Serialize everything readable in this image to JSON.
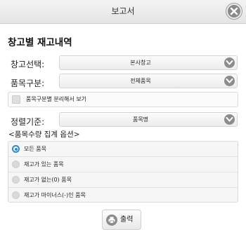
{
  "dialog": {
    "title": "보고서"
  },
  "heading": "창고별 재고내역",
  "fields": {
    "warehouse": {
      "label": "창고선택:",
      "value": "본사창고"
    },
    "category": {
      "label": "품목구분:",
      "value": "전체품목"
    },
    "separate_checkbox": {
      "label": "품목구분별 분리해서 보기",
      "checked": false
    },
    "sort": {
      "label": "정렬기준:",
      "value": "품목명"
    }
  },
  "options": {
    "title": "<품목수량 집계 옵션>",
    "items": [
      {
        "label": "모든 품목",
        "selected": true
      },
      {
        "label": "재고가 있는 품목",
        "selected": false
      },
      {
        "label": "재고가 없는(0) 품목",
        "selected": false
      },
      {
        "label": "재고가 마이너스(-)인 품목",
        "selected": false
      }
    ]
  },
  "print_button": {
    "label": "출력"
  },
  "icons": {
    "close": "close-icon",
    "dropdown": "chevron-down-icon",
    "print": "print-icon"
  },
  "colors": {
    "accent": "#2b88d8",
    "icon_gray": "#8c8c8c"
  }
}
